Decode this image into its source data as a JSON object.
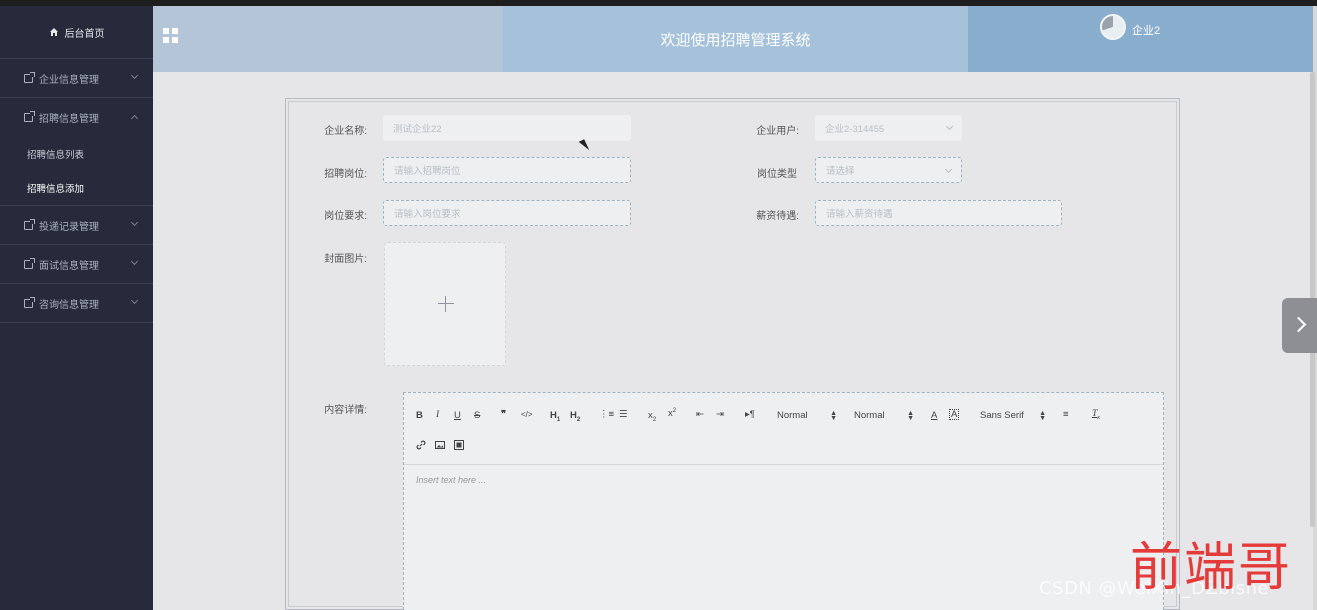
{
  "sidebar": {
    "home": "后台首页",
    "items": [
      {
        "label": "企业信息管理",
        "expanded": false
      },
      {
        "label": "招聘信息管理",
        "expanded": true,
        "children": [
          "招聘信息列表",
          "招聘信息添加"
        ],
        "active_child": "招聘信息添加"
      },
      {
        "label": "投递记录管理",
        "expanded": false
      },
      {
        "label": "面试信息管理",
        "expanded": false
      },
      {
        "label": "咨询信息管理",
        "expanded": false
      }
    ]
  },
  "header": {
    "title": "欢迎使用招聘管理系统",
    "user": "企业2"
  },
  "form": {
    "company_name_label": "企业名称:",
    "company_name_value": "测试企业22",
    "company_user_label": "企业用户:",
    "company_user_value": "企业2-314455",
    "position_label": "招聘岗位:",
    "position_placeholder": "请输入招聘岗位",
    "job_type_label": "岗位类型",
    "job_type_placeholder": "请选择",
    "requirement_label": "岗位要求:",
    "requirement_placeholder": "请输入岗位要求",
    "salary_label": "薪资待遇:",
    "salary_placeholder": "请输入薪资待遇",
    "cover_label": "封面图片:",
    "content_label": "内容详情:"
  },
  "editor": {
    "header_select": "Normal",
    "size_select": "Normal",
    "font_select": "Sans Serif",
    "placeholder": "Insert text here ..."
  },
  "watermark": {
    "csdn": "CSDN @WeiXin_DZbishe",
    "big": "前端哥"
  },
  "colors": {
    "sidebar_bg": "#262a3a",
    "header_left": "#b4c5d8",
    "header_mid": "#a5c2da",
    "header_right": "#89aecd",
    "content_bg": "#e6e6e8"
  }
}
